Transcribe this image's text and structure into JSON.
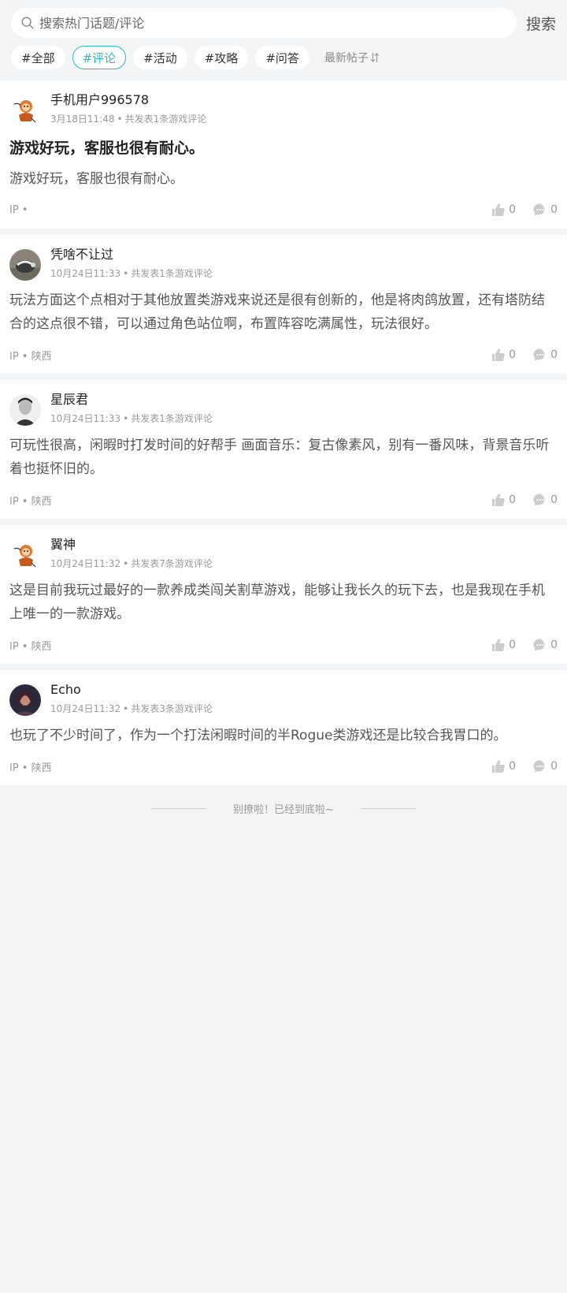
{
  "search": {
    "placeholder": "搜索热门话题/评论",
    "button_label": "搜索"
  },
  "tags": [
    {
      "label": "#全部",
      "active": false
    },
    {
      "label": "#评论",
      "active": true
    },
    {
      "label": "#活动",
      "active": false
    },
    {
      "label": "#攻略",
      "active": false
    },
    {
      "label": "#问答",
      "active": false
    }
  ],
  "sort_label": "最新帖子",
  "accent_color": "#2fb7c1",
  "posts": [
    {
      "username": "手机用户996578",
      "time": "3月18日11:48",
      "stat": "共发表1条游戏评论",
      "title": "游戏好玩，客服也很有耐心。",
      "body": "游戏好玩，客服也很有耐心。",
      "ip": "IP •",
      "likes": "0",
      "comments": "0",
      "avatar": "monkey-cartoon"
    },
    {
      "username": "凭啥不让过",
      "time": "10月24日11:33",
      "stat": "共发表1条游戏评论",
      "title": "",
      "body": "玩法方面这个点相对于其他放置类游戏来说还是很有创新的，他是将肉鸽放置，还有塔防结合的这点很不错，可以通过角色站位啊，布置阵容吃满属性，玩法很好。",
      "ip": "IP • 陕西",
      "likes": "0",
      "comments": "0",
      "avatar": "badger-photo"
    },
    {
      "username": "星辰君",
      "time": "10月24日11:33",
      "stat": "共发表1条游戏评论",
      "title": "",
      "body": "可玩性很高，闲暇时打发时间的好帮手 画面音乐：复古像素风，别有一番风味，背景音乐听着也挺怀旧的。",
      "ip": "IP • 陕西",
      "likes": "0",
      "comments": "0",
      "avatar": "bw-portrait"
    },
    {
      "username": "翼神",
      "time": "10月24日11:32",
      "stat": "共发表7条游戏评论",
      "title": "",
      "body": "这是目前我玩过最好的一款养成类闯关割草游戏，能够让我长久的玩下去，也是我现在手机上唯一的一款游戏。",
      "ip": "IP • 陕西",
      "likes": "0",
      "comments": "0",
      "avatar": "monkey-cartoon"
    },
    {
      "username": "Echo",
      "time": "10月24日11:32",
      "stat": "共发表3条游戏评论",
      "title": "",
      "body": "也玩了不少时间了，作为一个打法闲暇时间的半Rogue类游戏还是比较合我胃口的。",
      "ip": "IP • 陕西",
      "likes": "0",
      "comments": "0",
      "avatar": "dark-portrait"
    }
  ],
  "end_text": "别撩啦！已经到底啦~"
}
